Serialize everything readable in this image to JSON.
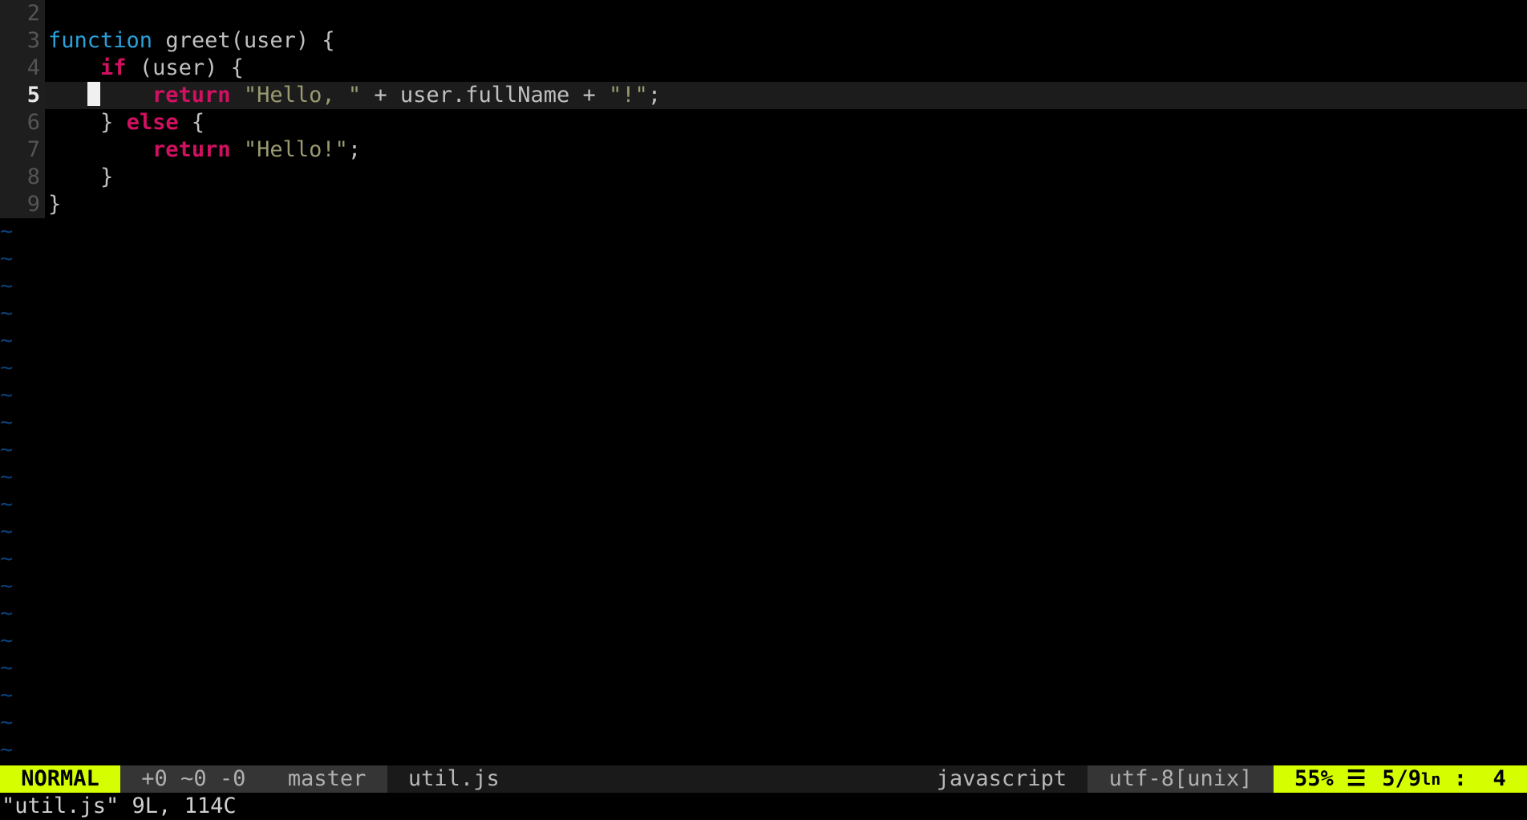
{
  "gutter": {
    "lines": [
      "2",
      "3",
      "4",
      "5",
      "6",
      "7",
      "8",
      "9"
    ],
    "current_index": 3
  },
  "code": {
    "l2": "",
    "l3": {
      "kw": "function",
      "sp1": " ",
      "name": "greet",
      "lp": "(",
      "arg": "user",
      "rp": ")",
      "sp2": " ",
      "ob": "{"
    },
    "l4": {
      "indent": "    ",
      "kw": "if",
      "sp1": " ",
      "lp": "(",
      "arg": "user",
      "rp": ")",
      "sp2": " ",
      "ob": "{"
    },
    "l5": {
      "pre_cursor": "   ",
      "post_cursor": "    ",
      "kw": "return",
      "sp1": " ",
      "s1": "\"Hello, \"",
      "sp2": " ",
      "op1": "+",
      "sp3": " ",
      "expr": "user.fullName",
      "sp4": " ",
      "op2": "+",
      "sp5": " ",
      "s2": "\"!\"",
      "semi": ";"
    },
    "l6": {
      "indent": "    ",
      "cb": "}",
      "sp1": " ",
      "kw": "else",
      "sp2": " ",
      "ob": "{"
    },
    "l7": {
      "indent": "        ",
      "kw": "return",
      "sp1": " ",
      "s1": "\"Hello!\"",
      "semi": ";"
    },
    "l8": {
      "indent": "    ",
      "cb": "}"
    },
    "l9": {
      "cb": "}"
    }
  },
  "tilde": "~",
  "status": {
    "mode": " NORMAL ",
    "hunks": " +0 ~0 -0 ",
    "branch": " master ",
    "file": " util.js",
    "filetype": "javascript ",
    "encoding": " utf-8[unix] ",
    "percent": " 55% ",
    "trigram": "☰",
    "pos_line": "5",
    "pos_sep1": "/",
    "pos_total": "9",
    "ln": "ln",
    "pos_sep2": " : ",
    "pos_col": " 4 "
  },
  "cmdline": "\"util.js\" 9L, 114C"
}
